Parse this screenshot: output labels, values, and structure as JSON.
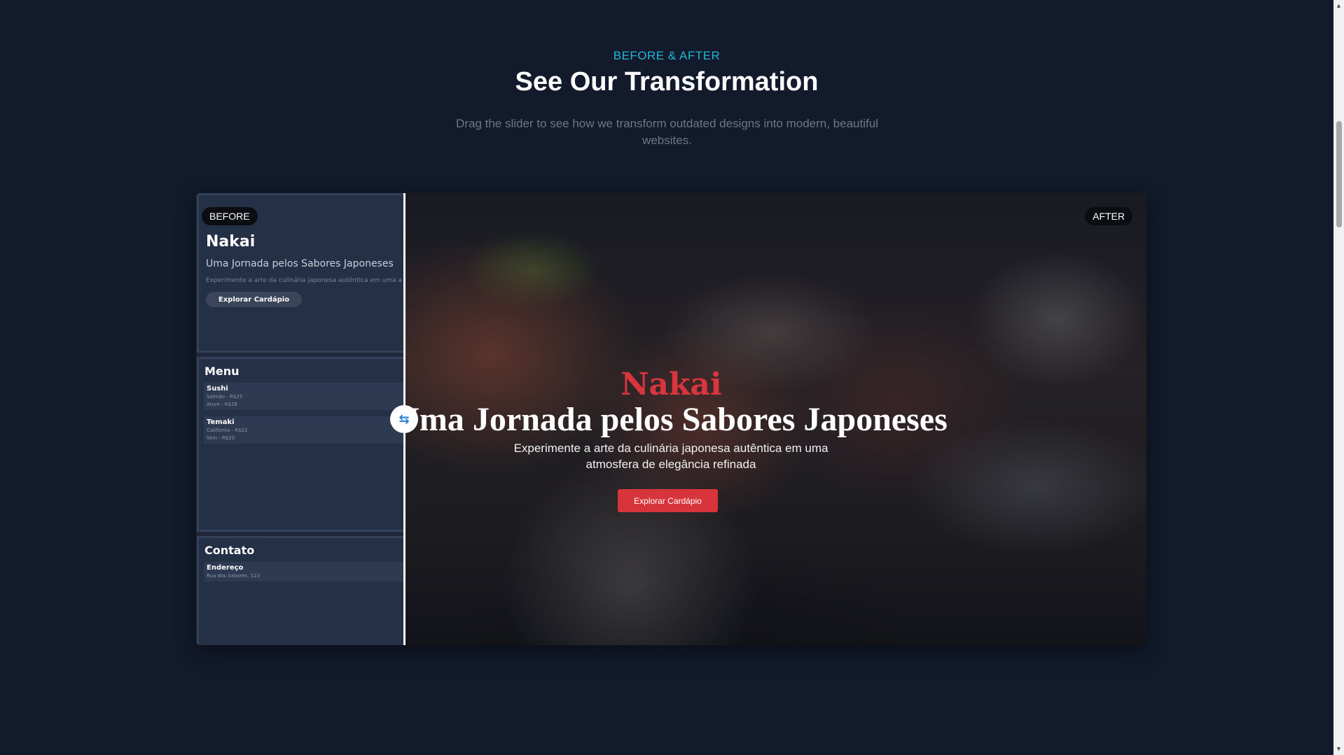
{
  "section": {
    "eyebrow": "BEFORE & AFTER",
    "title": "See Our Transformation",
    "subtitle": "Drag the slider to see how we transform outdated designs into modern, beautiful websites."
  },
  "slider": {
    "position_percent": 22,
    "handle_icon": "swap-horizontal-icon",
    "handle_glyph": "⇆"
  },
  "before": {
    "badge": "BEFORE",
    "brand": "Nakai",
    "subtitle": "Uma Jornada pelos Sabores Japoneses",
    "description": "Experimente a arte da culinária japonesa autêntica em uma a",
    "button": "Explorar Cardápio",
    "menu": {
      "title": "Menu",
      "items": [
        {
          "name": "Sushi",
          "lines": [
            "Salmão - R$25",
            "Atum - R$28"
          ]
        },
        {
          "name": "Temaki",
          "lines": [
            "Califórnia - R$22",
            "Skin - R$20"
          ]
        }
      ]
    },
    "contact": {
      "title": "Contato",
      "items": [
        {
          "name": "Endereço",
          "lines": [
            "Rua dos Sabores, 123"
          ]
        }
      ]
    }
  },
  "after": {
    "badge": "AFTER",
    "brand": "Nakai",
    "heading": "Uma Jornada pelos Sabores Japoneses",
    "description": "Experimente a arte da culinária japonesa autêntica em uma atmosfera de elegância refinada",
    "button": "Explorar Cardápio"
  },
  "colors": {
    "page_background": "#121a2b",
    "accent": "#22b7d8",
    "brand_red": "#d7343c"
  }
}
